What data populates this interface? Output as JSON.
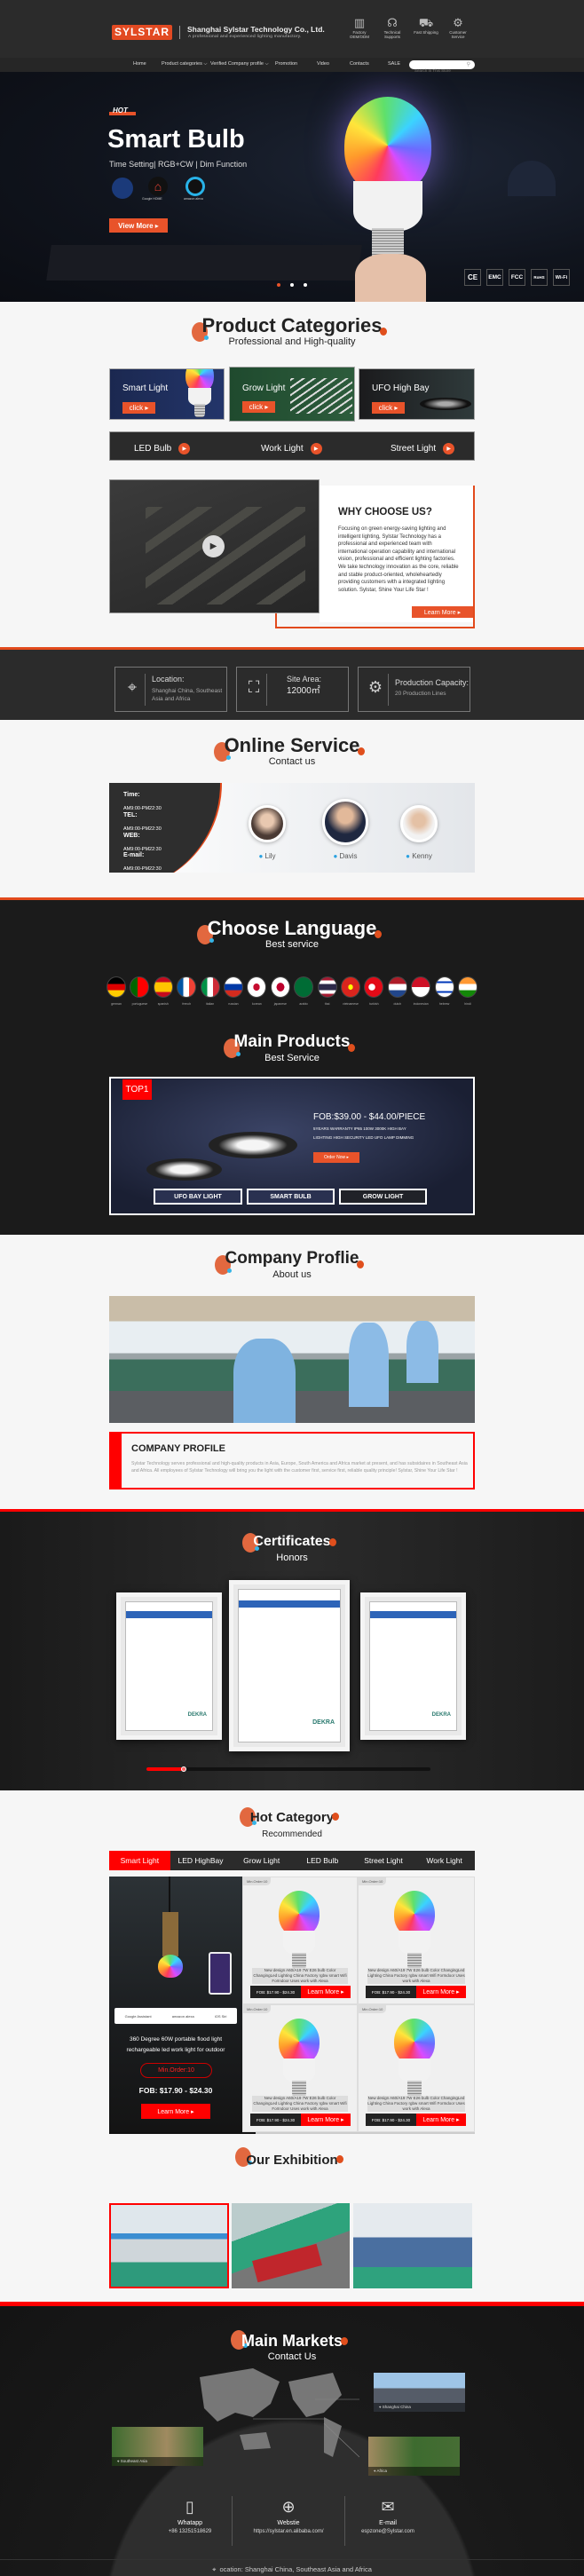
{
  "header": {
    "logo": "SYLSTAR",
    "company_name": "Shanghai Sylstar Technology Co., Ltd.",
    "tagline": "A professional and experienced lighting manufactory.",
    "features": [
      {
        "icon": "factory-icon",
        "label": "Factory OEM/ODM"
      },
      {
        "icon": "technical-support-icon",
        "label": "Technical Supports"
      },
      {
        "icon": "truck-icon",
        "label": "Fast Shipping"
      },
      {
        "icon": "handshake-icon",
        "label": "Customer Service"
      }
    ]
  },
  "nav": {
    "items": [
      "Home",
      "Product categories ⌵",
      "Verified Company profile ⌵",
      "Promotion",
      "Video",
      "Contacts",
      "SALE"
    ],
    "search_placeholder": "Search In This Store"
  },
  "hero": {
    "badge": "HOT",
    "title": "Smart Bulb",
    "subtitle": "Time Setting| RGB+CW |  Dim Function",
    "compat": [
      "Tmall Genie",
      "Google HOME",
      "amazon alexa"
    ],
    "cta": "View More ▸",
    "certs": [
      "CE",
      "EMC",
      "FCC",
      "RoHS",
      "Wi-Fi"
    ],
    "slides": 3,
    "active_slide": 1,
    "accent": "#e8532a"
  },
  "categories": {
    "title": "Product Categories",
    "subtitle": "Professional and High-quality",
    "cards": [
      {
        "label": "Smart Light",
        "cta": "click ▸"
      },
      {
        "label": "Grow Light",
        "cta": "click ▸"
      },
      {
        "label": "UFO High Bay",
        "cta": "click ▸"
      }
    ],
    "strip": [
      "LED Bulb",
      "Work Light",
      "Street Light"
    ]
  },
  "why": {
    "title": "WHY CHOOSE US?",
    "body": "Focusing on green energy-saving lighting and intelligent lighting, Sylstar Technology has a professional and experienced team with international operation capability and international vision, professional and efficient lighting factories. We take technology innovation as the core, reliable and stable product-oriented, wholeheartedly providing customers with a integrated lighting solution. Sylstar, Shine Your Life Star !",
    "cta": "Learn More ▸"
  },
  "stats": [
    {
      "icon": "location-pin-icon",
      "label": "Location:",
      "value": "Shanghai China, Southeast Asia and Africa"
    },
    {
      "icon": "area-icon",
      "label": "Site Area:",
      "value": "12000㎡"
    },
    {
      "icon": "gears-icon",
      "label": "Production Capacity:",
      "value": "20 Production Lines"
    }
  ],
  "online_service": {
    "title": "Online Service",
    "subtitle": "Contact us",
    "info": [
      {
        "label": "Time:",
        "value": "AM9:00-PM22:30"
      },
      {
        "label": "TEL:",
        "value": "AM9:00-PM22:30"
      },
      {
        "label": "WEB:",
        "value": "AM9:00-PM22:30"
      },
      {
        "label": "E-mail:",
        "value": "AM9:00-PM22:30"
      }
    ],
    "agents": [
      "Lily",
      "Davis",
      "Kenny"
    ]
  },
  "languages": {
    "title": "Choose Language",
    "subtitle": "Best service",
    "items": [
      {
        "label": "german",
        "flag": "de"
      },
      {
        "label": "portuguese",
        "flag": "pt"
      },
      {
        "label": "spanish",
        "flag": "es"
      },
      {
        "label": "french",
        "flag": "fr"
      },
      {
        "label": "italian",
        "flag": "it"
      },
      {
        "label": "russian",
        "flag": "ru"
      },
      {
        "label": "korean",
        "flag": "kr"
      },
      {
        "label": "japanese",
        "flag": "jp"
      },
      {
        "label": "arabic",
        "flag": "sa"
      },
      {
        "label": "thai",
        "flag": "th"
      },
      {
        "label": "vietnamese",
        "flag": "vn"
      },
      {
        "label": "turkish",
        "flag": "tr"
      },
      {
        "label": "dutch",
        "flag": "nl"
      },
      {
        "label": "indonesian",
        "flag": "id"
      },
      {
        "label": "hebrew",
        "flag": "il"
      },
      {
        "label": "hindi",
        "flag": "in"
      }
    ]
  },
  "main_products": {
    "title": "Main Products",
    "subtitle": "Best Service",
    "badge": "TOP1",
    "price": "FOB:$39.00 - $44.00/PIECE",
    "desc_lines": [
      "5YEARS WARRANTY IP65 100W 3000K HIGH BAY",
      "LIGHTING HIGH SECURITY LED UFO LAMP DIMMING"
    ],
    "cta": "Order Now ▸",
    "buttons": [
      "UFO BAY LIGHT",
      "SMART BULB",
      "GROW LIGHT"
    ]
  },
  "company_profile": {
    "title": "Company Proflie",
    "subtitle": "About us",
    "heading": "COMPANY PROFILE",
    "body": "Sylstar Technology serves professional and high-quality products in Asia, Europe, South America and Africa market at present, and has subsidaires in Southeast Asia and Africa. All employees of Sylstar Technology will bring you the light with the customer first, service first, reliable quality principle! Sylstar, Shine Your Life Star !"
  },
  "certificates": {
    "title": "Certificates",
    "subtitle": "Honors",
    "brand": "DEKRA",
    "scroll_progress": 0.13
  },
  "hot_category": {
    "title": "Hot Category",
    "subtitle": "Recommended",
    "tabs": [
      "Smart Light",
      "LED HighBay",
      "Grow Light",
      "LED Bulb",
      "Street Light",
      "Work Light"
    ],
    "active_tab": 0,
    "featured": {
      "compat": [
        "Google Assistant",
        "amazon alexa",
        "iOS Siri"
      ],
      "title": "360 Degree 60W portable flood light rechargeable led work light for outdoor",
      "min_order": "Min.Order:10",
      "price": "FOB: $17.90 - $24.30",
      "cta": "Learn More ▸"
    },
    "products": [
      {
        "min_order": "Min.Order:10",
        "desc": "New design A60/A19 7W E26 bulb Color ChangingLed Lighting China Factory rgbw smart Wifi ForIndoor Uses work with Alexa",
        "price": "FOB: $17.90 - $24.30",
        "cta": "Learn More ▸"
      },
      {
        "min_order": "Min.Order:10",
        "desc": "New design A60/A19 7W E26 bulb Color ChangingLed Lighting China Factory rgbw smart Wifi ForIndoor Uses work with Alexa",
        "price": "FOB: $17.90 - $24.30",
        "cta": "Learn More ▸"
      },
      {
        "min_order": "Min.Order:10",
        "desc": "New design A60/A19 7W E26 bulb Color ChangingLed Lighting China Factory rgbw smart Wifi ForIndoor Uses work with Alexa",
        "price": "FOB: $17.90 - $24.30",
        "cta": "Learn More ▸"
      },
      {
        "min_order": "Min.Order:10",
        "desc": "New design A60/A19 7W E26 bulb Color ChangingLed Lighting China Factory rgbw smart Wifi ForIndoor Uses work with Alexa",
        "price": "FOB: $17.90 - $24.30",
        "cta": "Learn More ▸"
      }
    ]
  },
  "exhibition": {
    "title": "Our Exhibition",
    "selected": 0
  },
  "markets": {
    "title": "Main Markets",
    "subtitle": "Contact Us",
    "places": [
      "Shanghai China",
      "Southeast Asia",
      "Africa"
    ],
    "contacts": [
      {
        "icon": "phone-icon",
        "label": "Whatapp",
        "value": "+86 13251518629"
      },
      {
        "icon": "globe-icon",
        "label": "Webstie",
        "value": "https://sylstar.en.alibaba.com/"
      },
      {
        "icon": "mail-icon",
        "label": "E-mail",
        "value": "espzone@Sylstar.com"
      }
    ],
    "footer_location": "ocation: Shanghai China,  Southeast Asia and Africa"
  }
}
